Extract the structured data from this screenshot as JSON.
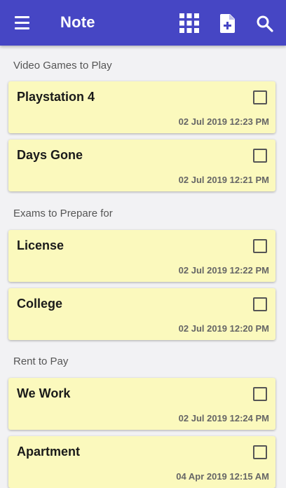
{
  "appbar": {
    "title": "Note",
    "background_color": "#4646c4",
    "icons": [
      "menu-icon",
      "grid-view-icon",
      "add-note-icon",
      "search-icon"
    ]
  },
  "sections": [
    {
      "header": "Video Games to Play",
      "notes": [
        {
          "title": "Playstation 4",
          "timestamp": "02 Jul 2019 12:23 PM",
          "checked": false
        },
        {
          "title": "Days Gone",
          "timestamp": "02 Jul 2019 12:21 PM",
          "checked": false
        }
      ]
    },
    {
      "header": "Exams to Prepare for",
      "notes": [
        {
          "title": "License",
          "timestamp": "02 Jul 2019 12:22 PM",
          "checked": false
        },
        {
          "title": "College",
          "timestamp": "02 Jul 2019 12:20 PM",
          "checked": false
        }
      ]
    },
    {
      "header": "Rent to Pay",
      "notes": [
        {
          "title": "We Work",
          "timestamp": "02 Jul 2019 12:24 PM",
          "checked": false
        },
        {
          "title": "Apartment",
          "timestamp": "04 Apr 2019 12:15 AM",
          "checked": false
        }
      ]
    }
  ],
  "colors": {
    "card_background": "#fbf9bd",
    "page_background": "#f2f2f4"
  }
}
